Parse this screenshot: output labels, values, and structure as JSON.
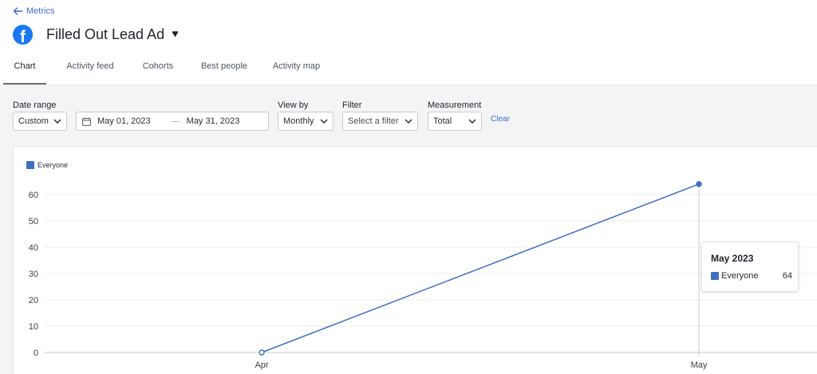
{
  "header": {
    "back_label": "Metrics",
    "title": "Filled Out Lead Ad",
    "logo_glyph": "f",
    "brand_color": "#1877f2"
  },
  "tabs": [
    {
      "label": "Chart",
      "active": true
    },
    {
      "label": "Activity feed",
      "active": false
    },
    {
      "label": "Cohorts",
      "active": false
    },
    {
      "label": "Best people",
      "active": false
    },
    {
      "label": "Activity map",
      "active": false
    }
  ],
  "filters": {
    "date_range": {
      "label": "Date range",
      "value": "Custom",
      "start": "May 01, 2023",
      "end": "May 31, 2023"
    },
    "view_by": {
      "label": "View by",
      "value": "Monthly"
    },
    "filter": {
      "label": "Filter",
      "placeholder": "Select a filter"
    },
    "measurement": {
      "label": "Measurement",
      "value": "Total"
    },
    "clear_label": "Clear"
  },
  "chart_data": {
    "type": "line",
    "categories": [
      "Apr",
      "May"
    ],
    "series": [
      {
        "name": "Everyone",
        "values": [
          0,
          64
        ],
        "color": "#3e6fc2"
      }
    ],
    "y_ticks": [
      0,
      10,
      20,
      30,
      40,
      50,
      60
    ],
    "ylim": [
      0,
      64
    ],
    "grid": true,
    "legend": "top-left"
  },
  "tooltip": {
    "title": "May 2023",
    "series_name": "Everyone",
    "value": "64"
  }
}
